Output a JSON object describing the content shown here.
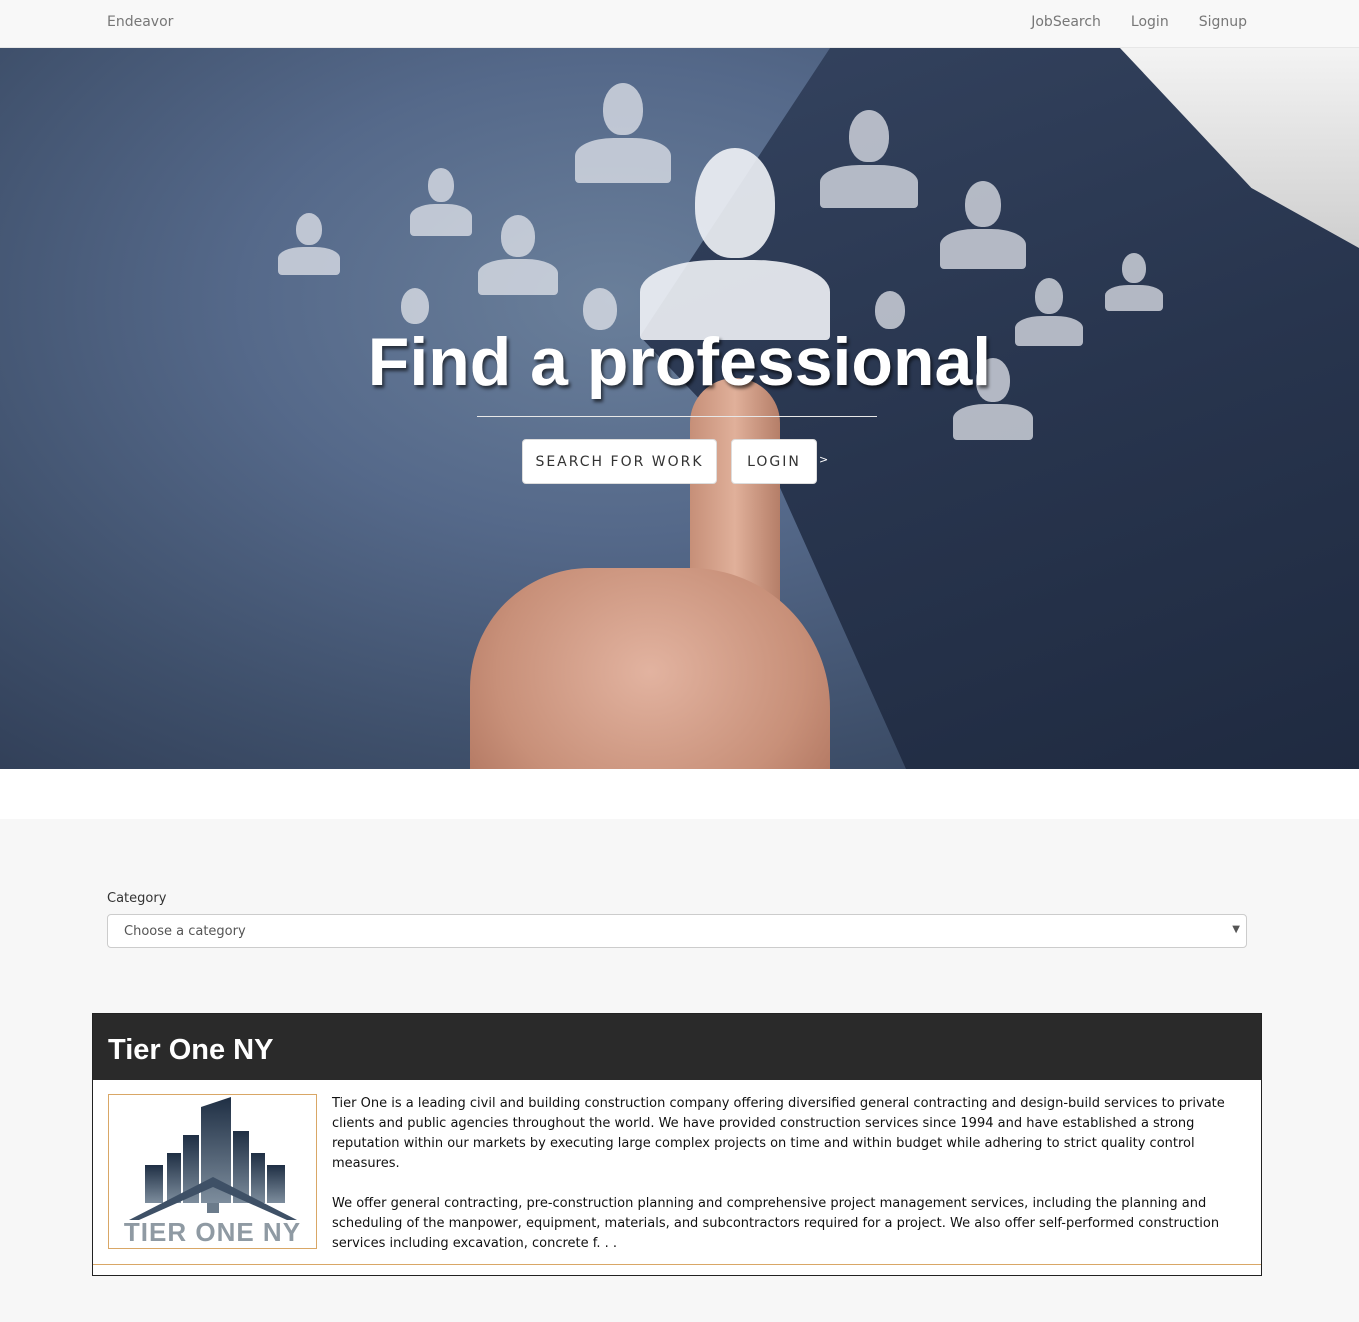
{
  "navbar": {
    "brand": "Endeavor",
    "links": [
      "JobSearch",
      "Login",
      "Signup"
    ]
  },
  "hero": {
    "title": "Find a professional",
    "search_button": "SEARCH FOR WORK",
    "login_button": "LOGIN",
    "arrow": ">"
  },
  "category": {
    "label": "Category",
    "selected": "Choose a category"
  },
  "listing": {
    "title": "Tier One NY",
    "logo_text": "TIER ONE NY",
    "paragraph1": "Tier One is a leading civil and building construction company offering diversified general contracting and design-build services to private clients and public agencies throughout the world. We have provided construction services since 1994 and have established a strong reputation within our markets by executing large complex projects on time and within budget while adhering to strict quality control measures.",
    "paragraph2": "We offer general contracting, pre-construction planning and comprehensive project management services, including the planning and scheduling of the manpower, equipment, materials, and subcontractors required for a project. We also offer self-performed construction services including excavation, concrete f. . ."
  },
  "colors": {
    "card_header": "#2a2a2a",
    "accent": "#d9a766"
  }
}
